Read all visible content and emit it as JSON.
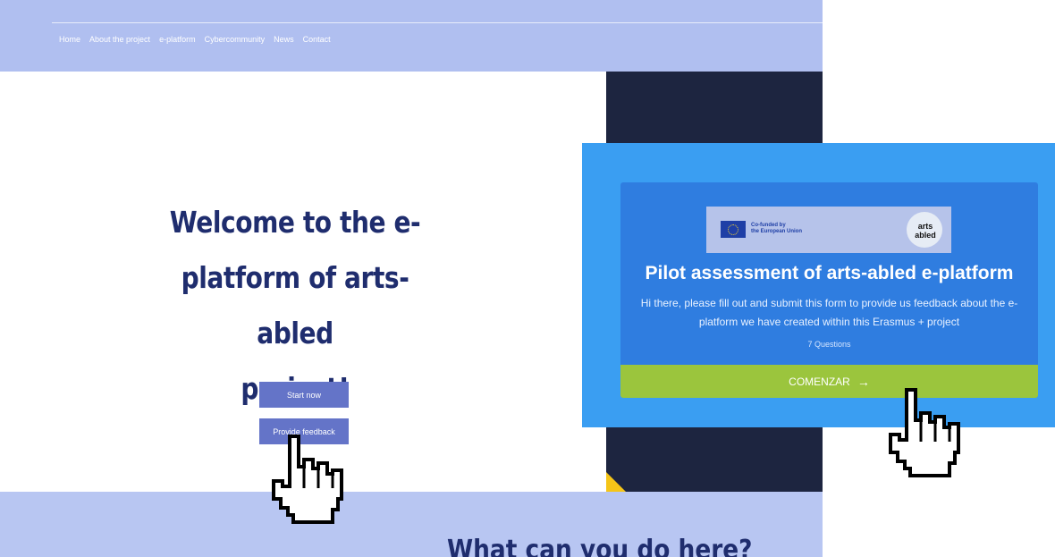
{
  "nav": {
    "items": [
      "Home",
      "About the project",
      "e-platform",
      "Cybercommunity",
      "News",
      "Contact"
    ]
  },
  "hero": {
    "title_lines": [
      "Welcome to the e-",
      "platform of arts-abled",
      "project!"
    ],
    "start_button": "Start now",
    "feedback_button": "Provide feedback"
  },
  "section": {
    "heading": "What can you do here?"
  },
  "popup": {
    "eu_text_line1": "Co-funded by",
    "eu_text_line2": "the European Union",
    "logo_line1": "arts",
    "logo_line2": "abled",
    "title": "Pilot assessment of arts-abled e-platform",
    "description": "Hi there, please fill out and submit this form to provide us feedback about the e-platform we have created within this Erasmus + project",
    "question_count": "7 Questions",
    "start_label": "COMENZAR",
    "arrow_icon": "→"
  },
  "colors": {
    "topbar": "#b0bff0",
    "dark_panel": "#1d2540",
    "button": "#6474c8",
    "popup_bg": "#3a9ef2",
    "card_bg": "#2f7de0",
    "start_bar": "#9bc53d",
    "heading": "#1f2d6e"
  }
}
